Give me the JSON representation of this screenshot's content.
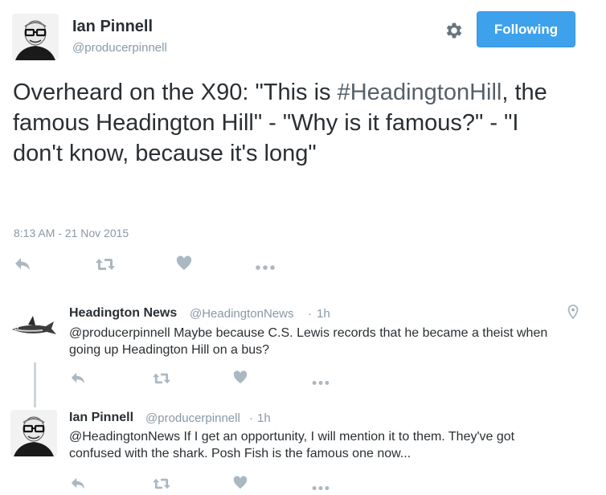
{
  "main_tweet": {
    "author_name": "Ian Pinnell",
    "author_handle": "@producerpinnell",
    "follow_label": "Following",
    "text_before": "Overheard on the X90: \"This is ",
    "hashtag": "#HeadingtonHill",
    "text_after": ", the famous Headington Hill\" - \"Why is it famous?\" - \"I don't know, because it's long\"",
    "timestamp": "8:13 AM - 21 Nov 2015",
    "icons": [
      "reply-icon",
      "retweet-icon",
      "like-icon",
      "more-icon"
    ]
  },
  "replies": [
    {
      "author_name": "Headington News",
      "author_handle": "@HeadingtonNews",
      "separator": "·",
      "time": "1h",
      "text": "@producerpinnell Maybe because C.S. Lewis records that he became a theist when going up Headington Hill on a bus?",
      "has_location": true
    },
    {
      "author_name": "Ian Pinnell",
      "author_handle": "@producerpinnell",
      "separator": "·",
      "time": "1h",
      "text": "@HeadingtonNews If I get an opportunity, I will mention it to them. They've got confused with the shark. Posh Fish is the famous one now...",
      "has_location": false
    }
  ],
  "colors": {
    "text": "#292f33",
    "muted": "#8899a6",
    "icon": "#aab8c2",
    "follow_button": "#3ea1ec",
    "thread_line": "#ccd6dd"
  }
}
